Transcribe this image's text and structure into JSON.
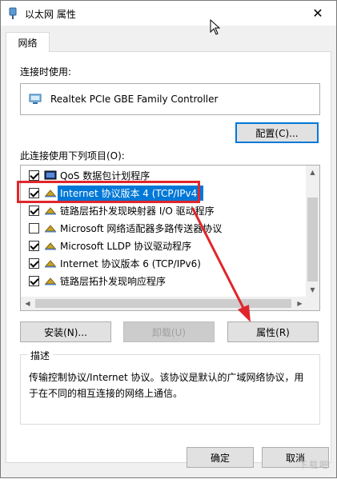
{
  "window": {
    "title": "以太网 属性",
    "close_glyph": "✕"
  },
  "tabs": [
    {
      "label": "网络"
    }
  ],
  "connect_using": {
    "label": "连接时使用:",
    "adapter": "Realtek PCIe GBE Family Controller",
    "configure_button": "配置(C)..."
  },
  "items_section": {
    "label": "此连接使用下列项目(O):",
    "items": [
      {
        "label": "QoS 数据包计划程序",
        "checked": true,
        "icon": "qos-scheduler-icon"
      },
      {
        "label": "Internet 协议版本 4 (TCP/IPv4)",
        "checked": true,
        "selected": true,
        "icon": "network-protocol-icon"
      },
      {
        "label": "链路层拓扑发现映射器 I/O 驱动程序",
        "checked": true,
        "icon": "network-protocol-icon"
      },
      {
        "label": "Microsoft 网络适配器多路传送器协议",
        "checked": false,
        "icon": "network-protocol-icon"
      },
      {
        "label": "Microsoft LLDP 协议驱动程序",
        "checked": true,
        "icon": "network-protocol-icon"
      },
      {
        "label": "Internet 协议版本 6 (TCP/IPv6)",
        "checked": true,
        "icon": "network-protocol-icon"
      },
      {
        "label": "链路层拓扑发现响应程序",
        "checked": true,
        "icon": "network-protocol-icon"
      }
    ]
  },
  "action_buttons": {
    "install": "安装(N)...",
    "uninstall": "卸载(U)",
    "properties": "属性(R)"
  },
  "description": {
    "legend": "描述",
    "text": "传输控制协议/Internet 协议。该协议是默认的广域网络协议，用于在不同的相互连接的网络上通信。"
  },
  "footer": {
    "ok": "确定",
    "cancel": "取消"
  },
  "watermark": "下载吧",
  "colors": {
    "selection": "#0078d7",
    "annotation": "#e0262b"
  }
}
